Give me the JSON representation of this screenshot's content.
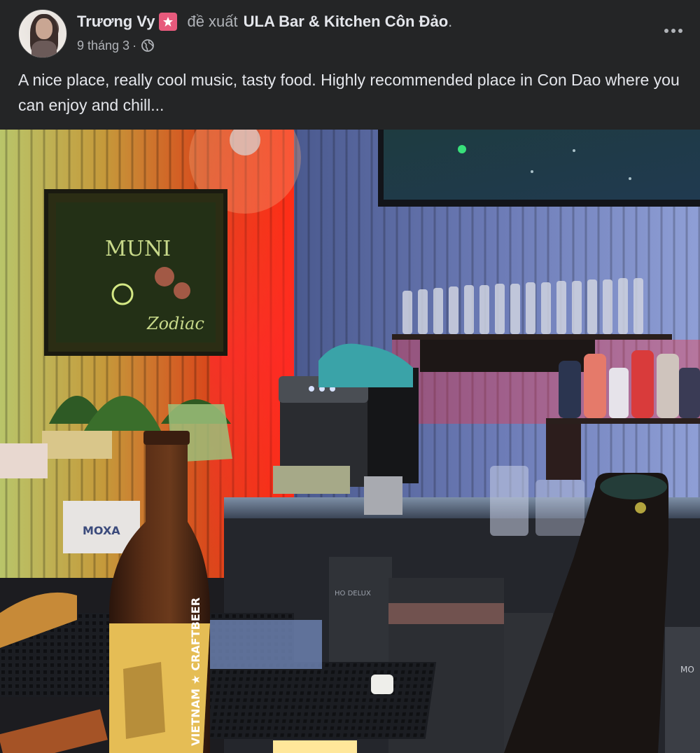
{
  "post": {
    "author": "Trương Vy",
    "badge_icon": "badge-icon",
    "verb": "đề xuất",
    "place": "ULA Bar & Kitchen Côn Đảo",
    "period": ".",
    "date": "9 tháng 3",
    "separator": "·",
    "privacy_icon": "globe-icon",
    "more_icon": "more-options-icon",
    "text": "A nice place, really cool music, tasty food. Highly recommended place in Con Dao where you can enjoy and chill...",
    "photo": {
      "sign_text_top": "MUNI",
      "sign_text_bottom": "Zodiac",
      "box_label": "MOXA",
      "machine_label": "HO DELUX",
      "bottle_label": "VIETNAM ★ CRAFTBEER",
      "fridge_label": "MO"
    }
  },
  "colors": {
    "background": "#242526",
    "primary_text": "#e4e6eb",
    "secondary_text": "#b0b3b8",
    "badge": "#e75a7c"
  }
}
